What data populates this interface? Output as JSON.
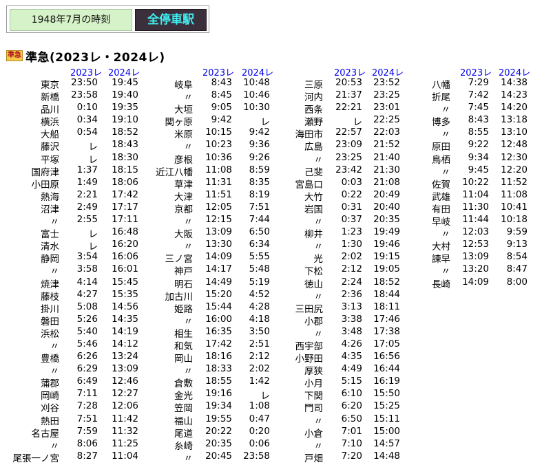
{
  "header": {
    "date_label": "1948年7月の時刻",
    "mode_tab": "全停車駅"
  },
  "train": {
    "badge": "準急",
    "name": "準急(2023レ・2024レ)"
  },
  "columns": [
    {
      "headers": [
        "2023レ",
        "2024レ"
      ],
      "rows": [
        {
          "station": "東京",
          "t1": "23:50",
          "t2": "19:45"
        },
        {
          "station": "新橋",
          "t1": "23:58",
          "t2": "19:40"
        },
        {
          "station": "品川",
          "t1": "0:10",
          "t2": "19:35"
        },
        {
          "station": "横浜",
          "t1": "0:34",
          "t2": "19:10"
        },
        {
          "station": "大船",
          "t1": "0:54",
          "t2": "18:52"
        },
        {
          "station": "藤沢",
          "t1": "レ",
          "t2": "18:43"
        },
        {
          "station": "平塚",
          "t1": "レ",
          "t2": "18:30"
        },
        {
          "station": "国府津",
          "t1": "1:37",
          "t2": "18:15"
        },
        {
          "station": "小田原",
          "t1": "1:49",
          "t2": "18:06"
        },
        {
          "station": "熱海",
          "t1": "2:21",
          "t2": "17:42"
        },
        {
          "station": "沼津",
          "t1": "2:49",
          "t2": "17:17"
        },
        {
          "station": "〃",
          "t1": "2:55",
          "t2": "17:11"
        },
        {
          "station": "富士",
          "t1": "レ",
          "t2": "16:48"
        },
        {
          "station": "清水",
          "t1": "レ",
          "t2": "16:20"
        },
        {
          "station": "静岡",
          "t1": "3:54",
          "t2": "16:06"
        },
        {
          "station": "〃",
          "t1": "3:58",
          "t2": "16:01"
        },
        {
          "station": "焼津",
          "t1": "4:14",
          "t2": "15:45"
        },
        {
          "station": "藤枝",
          "t1": "4:27",
          "t2": "15:35"
        },
        {
          "station": "掛川",
          "t1": "5:08",
          "t2": "14:56"
        },
        {
          "station": "磐田",
          "t1": "5:26",
          "t2": "14:35"
        },
        {
          "station": "浜松",
          "t1": "5:40",
          "t2": "14:19"
        },
        {
          "station": "〃",
          "t1": "5:46",
          "t2": "14:12"
        },
        {
          "station": "豊橋",
          "t1": "6:26",
          "t2": "13:24"
        },
        {
          "station": "〃",
          "t1": "6:29",
          "t2": "13:09"
        },
        {
          "station": "蒲郡",
          "t1": "6:49",
          "t2": "12:46"
        },
        {
          "station": "岡崎",
          "t1": "7:11",
          "t2": "12:27"
        },
        {
          "station": "刈谷",
          "t1": "7:28",
          "t2": "12:06"
        },
        {
          "station": "熱田",
          "t1": "7:51",
          "t2": "11:42"
        },
        {
          "station": "名古屋",
          "t1": "7:59",
          "t2": "11:32"
        },
        {
          "station": "〃",
          "t1": "8:06",
          "t2": "11:25"
        },
        {
          "station": "尾張一ノ宮",
          "t1": "8:27",
          "t2": "11:04"
        }
      ]
    },
    {
      "headers": [
        "2023レ",
        "2024レ"
      ],
      "rows": [
        {
          "station": "岐阜",
          "t1": "8:43",
          "t2": "10:48"
        },
        {
          "station": "〃",
          "t1": "8:45",
          "t2": "10:46"
        },
        {
          "station": "大垣",
          "t1": "9:05",
          "t2": "10:30"
        },
        {
          "station": "関ヶ原",
          "t1": "9:42",
          "t2": "レ"
        },
        {
          "station": "米原",
          "t1": "10:15",
          "t2": "9:42"
        },
        {
          "station": "〃",
          "t1": "10:23",
          "t2": "9:36"
        },
        {
          "station": "彦根",
          "t1": "10:36",
          "t2": "9:26"
        },
        {
          "station": "近江八幡",
          "t1": "11:08",
          "t2": "8:59"
        },
        {
          "station": "草津",
          "t1": "11:31",
          "t2": "8:35"
        },
        {
          "station": "大津",
          "t1": "11:51",
          "t2": "8:19"
        },
        {
          "station": "京都",
          "t1": "12:05",
          "t2": "7:51"
        },
        {
          "station": "〃",
          "t1": "12:15",
          "t2": "7:44"
        },
        {
          "station": "大阪",
          "t1": "13:09",
          "t2": "6:50"
        },
        {
          "station": "〃",
          "t1": "13:30",
          "t2": "6:34"
        },
        {
          "station": "三ノ宮",
          "t1": "14:09",
          "t2": "5:55"
        },
        {
          "station": "神戸",
          "t1": "14:17",
          "t2": "5:48"
        },
        {
          "station": "明石",
          "t1": "14:49",
          "t2": "5:19"
        },
        {
          "station": "加古川",
          "t1": "15:20",
          "t2": "4:52"
        },
        {
          "station": "姫路",
          "t1": "15:44",
          "t2": "4:28"
        },
        {
          "station": "〃",
          "t1": "16:00",
          "t2": "4:18"
        },
        {
          "station": "相生",
          "t1": "16:35",
          "t2": "3:50"
        },
        {
          "station": "和気",
          "t1": "17:42",
          "t2": "2:51"
        },
        {
          "station": "岡山",
          "t1": "18:16",
          "t2": "2:12"
        },
        {
          "station": "〃",
          "t1": "18:33",
          "t2": "2:02"
        },
        {
          "station": "倉敷",
          "t1": "18:55",
          "t2": "1:42"
        },
        {
          "station": "金光",
          "t1": "19:16",
          "t2": "レ"
        },
        {
          "station": "笠岡",
          "t1": "19:34",
          "t2": "1:08"
        },
        {
          "station": "福山",
          "t1": "19:55",
          "t2": "0:47"
        },
        {
          "station": "尾道",
          "t1": "20:22",
          "t2": "0:20"
        },
        {
          "station": "糸崎",
          "t1": "20:35",
          "t2": "0:06"
        },
        {
          "station": "〃",
          "t1": "20:45",
          "t2": "23:58"
        }
      ]
    },
    {
      "headers": [
        "2023レ",
        "2024レ"
      ],
      "rows": [
        {
          "station": "三原",
          "t1": "20:53",
          "t2": "23:52"
        },
        {
          "station": "河内",
          "t1": "21:37",
          "t2": "23:25"
        },
        {
          "station": "西条",
          "t1": "22:21",
          "t2": "23:01"
        },
        {
          "station": "瀬野",
          "t1": "レ",
          "t2": "22:25"
        },
        {
          "station": "海田市",
          "t1": "22:57",
          "t2": "22:03"
        },
        {
          "station": "広島",
          "t1": "23:09",
          "t2": "21:52"
        },
        {
          "station": "〃",
          "t1": "23:25",
          "t2": "21:40"
        },
        {
          "station": "己斐",
          "t1": "23:42",
          "t2": "21:30"
        },
        {
          "station": "宮島口",
          "t1": "0:03",
          "t2": "21:08"
        },
        {
          "station": "大竹",
          "t1": "0:22",
          "t2": "20:49"
        },
        {
          "station": "岩国",
          "t1": "0:31",
          "t2": "20:40"
        },
        {
          "station": "〃",
          "t1": "0:37",
          "t2": "20:35"
        },
        {
          "station": "柳井",
          "t1": "1:23",
          "t2": "19:49"
        },
        {
          "station": "〃",
          "t1": "1:30",
          "t2": "19:46"
        },
        {
          "station": "光",
          "t1": "2:02",
          "t2": "19:15"
        },
        {
          "station": "下松",
          "t1": "2:12",
          "t2": "19:05"
        },
        {
          "station": "徳山",
          "t1": "2:24",
          "t2": "18:52"
        },
        {
          "station": "〃",
          "t1": "2:36",
          "t2": "18:44"
        },
        {
          "station": "三田尻",
          "t1": "3:13",
          "t2": "18:11"
        },
        {
          "station": "小郡",
          "t1": "3:38",
          "t2": "17:46"
        },
        {
          "station": "〃",
          "t1": "3:48",
          "t2": "17:38"
        },
        {
          "station": "西宇部",
          "t1": "4:26",
          "t2": "17:05"
        },
        {
          "station": "小野田",
          "t1": "4:35",
          "t2": "16:56"
        },
        {
          "station": "厚狭",
          "t1": "4:49",
          "t2": "16:44"
        },
        {
          "station": "小月",
          "t1": "5:15",
          "t2": "16:19"
        },
        {
          "station": "下関",
          "t1": "6:10",
          "t2": "15:50"
        },
        {
          "station": "門司",
          "t1": "6:20",
          "t2": "15:25"
        },
        {
          "station": "〃",
          "t1": "6:50",
          "t2": "15:11"
        },
        {
          "station": "小倉",
          "t1": "7:01",
          "t2": "15:00"
        },
        {
          "station": "〃",
          "t1": "7:10",
          "t2": "14:57"
        },
        {
          "station": "戸畑",
          "t1": "7:20",
          "t2": "14:48"
        }
      ]
    },
    {
      "headers": [
        "2023レ",
        "2024レ"
      ],
      "rows": [
        {
          "station": "八幡",
          "t1": "7:29",
          "t2": "14:38"
        },
        {
          "station": "折尾",
          "t1": "7:42",
          "t2": "14:23"
        },
        {
          "station": "〃",
          "t1": "7:45",
          "t2": "14:20"
        },
        {
          "station": "博多",
          "t1": "8:43",
          "t2": "13:18"
        },
        {
          "station": "〃",
          "t1": "8:55",
          "t2": "13:10"
        },
        {
          "station": "原田",
          "t1": "9:22",
          "t2": "12:48"
        },
        {
          "station": "鳥栖",
          "t1": "9:34",
          "t2": "12:30"
        },
        {
          "station": "〃",
          "t1": "9:45",
          "t2": "12:20"
        },
        {
          "station": "佐賀",
          "t1": "10:22",
          "t2": "11:52"
        },
        {
          "station": "武雄",
          "t1": "11:04",
          "t2": "11:08"
        },
        {
          "station": "有田",
          "t1": "11:30",
          "t2": "10:41"
        },
        {
          "station": "早岐",
          "t1": "11:44",
          "t2": "10:18"
        },
        {
          "station": "〃",
          "t1": "12:03",
          "t2": "9:59"
        },
        {
          "station": "大村",
          "t1": "12:53",
          "t2": "9:13"
        },
        {
          "station": "諫早",
          "t1": "13:09",
          "t2": "8:54"
        },
        {
          "station": "〃",
          "t1": "13:20",
          "t2": "8:47"
        },
        {
          "station": "長崎",
          "t1": "14:09",
          "t2": "8:00"
        }
      ]
    }
  ]
}
